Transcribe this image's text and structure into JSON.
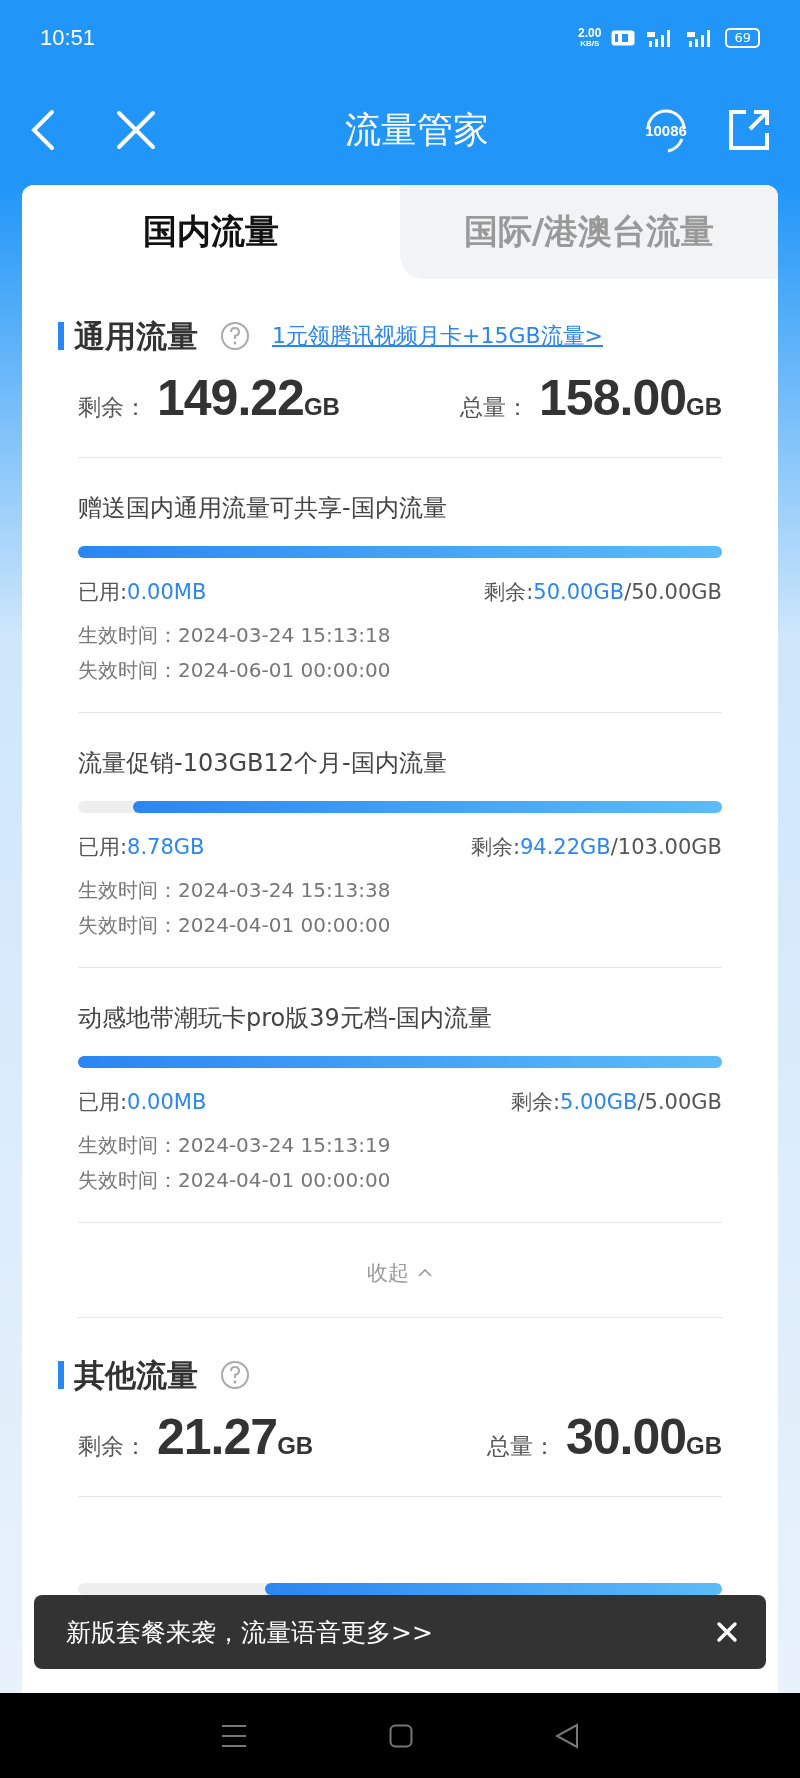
{
  "status_bar": {
    "time": "10:51",
    "speed": "2.00",
    "speed_unit": "KB/S",
    "battery": "69"
  },
  "header": {
    "title": "流量管家",
    "service_badge": "10086"
  },
  "tabs": [
    {
      "label": "国内流量",
      "selected": true
    },
    {
      "label": "国际/港澳台流量",
      "selected": false
    }
  ],
  "sections": [
    {
      "title": "通用流量",
      "promo_link": "1元领腾讯视频月卡+15GB流量>",
      "remaining_label": "剩余：",
      "remaining": "149.22",
      "remaining_unit": "GB",
      "total_label": "总量：",
      "total": "158.00",
      "total_unit": "GB",
      "collapse": "收起",
      "packages": [
        {
          "name": "赠送国内通用流量可共享-国内流量",
          "level": 1,
          "used_label": "已用:",
          "used": "0.00MB",
          "remaining_label": "剩余:",
          "remaining": "50.00GB",
          "total": "/50.00GB",
          "start_label": "生效时间：",
          "start": "2024-03-24 15:13:18",
          "end_label": "失效时间：",
          "end": "2024-06-01 00:00:00"
        },
        {
          "name": "流量促销-103GB12个月-国内流量",
          "level": 0.915,
          "used_label": "已用:",
          "used": "8.78GB",
          "remaining_label": "剩余:",
          "remaining": "94.22GB",
          "total": "/103.00GB",
          "start_label": "生效时间：",
          "start": "2024-03-24 15:13:38",
          "end_label": "失效时间：",
          "end": "2024-04-01 00:00:00"
        },
        {
          "name": "动感地带潮玩卡pro版39元档-国内流量",
          "level": 1,
          "used_label": "已用:",
          "used": "0.00MB",
          "remaining_label": "剩余:",
          "remaining": "5.00GB",
          "total": "/5.00GB",
          "start_label": "生效时间：",
          "start": "2024-03-24 15:13:19",
          "end_label": "失效时间：",
          "end": "2024-04-01 00:00:00"
        }
      ]
    },
    {
      "title": "其他流量",
      "remaining_label": "剩余：",
      "remaining": "21.27",
      "remaining_unit": "GB",
      "total_label": "总量：",
      "total": "30.00",
      "total_unit": "GB",
      "packages": [
        {
          "level": 0.71
        }
      ]
    }
  ],
  "toast": {
    "text": "新版套餐来袭，流量语音更多>>"
  }
}
